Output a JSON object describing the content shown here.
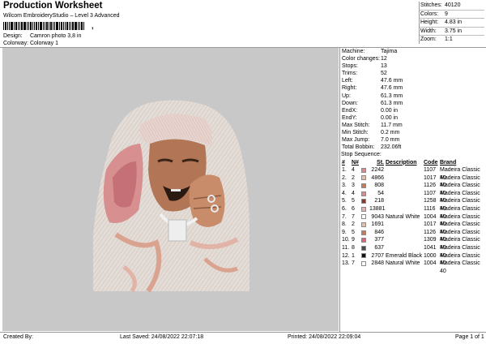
{
  "header": {
    "title": "Production Worksheet",
    "subtitle": "Wilcom EmbroideryStudio – Level 3 Advanced",
    "design_label": "Design:",
    "design_value": "Camron photo 3,8 in",
    "colorway_label": "Colorway:",
    "colorway_value": "Colorway 1"
  },
  "stats": [
    {
      "label": "Stitches:",
      "value": "40120"
    },
    {
      "label": "Colors:",
      "value": "9"
    },
    {
      "label": "Height:",
      "value": "4.83 in"
    },
    {
      "label": "Width:",
      "value": "3.75 in"
    },
    {
      "label": "Zoom:",
      "value": "1:1"
    }
  ],
  "properties": [
    {
      "label": "Machine:",
      "value": "Tajima"
    },
    {
      "label": "Color changes:",
      "value": "12"
    },
    {
      "label": "Stops:",
      "value": "13"
    },
    {
      "label": "Trims:",
      "value": "52"
    },
    {
      "label": "Left:",
      "value": "47.6 mm"
    },
    {
      "label": "Right:",
      "value": "47.6 mm"
    },
    {
      "label": "Up:",
      "value": "61.3 mm"
    },
    {
      "label": "Down:",
      "value": "61.3 mm"
    },
    {
      "label": "EndX:",
      "value": "0.00 in"
    },
    {
      "label": "EndY:",
      "value": "0.00 in"
    },
    {
      "label": "Max Stitch:",
      "value": "11.7 mm"
    },
    {
      "label": "Min Stitch:",
      "value": "0.2 mm"
    },
    {
      "label": "Max Jump:",
      "value": "7.0 mm"
    },
    {
      "label": "Total Bobbin:",
      "value": "232.06ft"
    }
  ],
  "stop_sequence": {
    "title": "Stop Sequence:",
    "headers": {
      "num": "#",
      "n": "N#",
      "st": "St.",
      "description": "Description",
      "code": "Code",
      "brand": "Brand"
    },
    "rows": [
      {
        "num": "1.",
        "n": "4",
        "color": "#d98a8e",
        "st": "2242",
        "description": "",
        "code": "1107",
        "brand": "Madeira Classic 40"
      },
      {
        "num": "2.",
        "n": "2",
        "color": "#e4c0a8",
        "st": "4866",
        "description": "",
        "code": "1017",
        "brand": "Madeira Classic 40"
      },
      {
        "num": "3.",
        "n": "3",
        "color": "#c9795c",
        "st": "808",
        "description": "",
        "code": "1126",
        "brand": "Madeira Classic 40"
      },
      {
        "num": "4.",
        "n": "4",
        "color": "#d98a8e",
        "st": "54",
        "description": "",
        "code": "1107",
        "brand": "Madeira Classic 40"
      },
      {
        "num": "5.",
        "n": "5",
        "color": "#8a3a2c",
        "st": "218",
        "description": "",
        "code": "1258",
        "brand": "Madeira Classic 40"
      },
      {
        "num": "6.",
        "n": "6",
        "color": "#e0b4b4",
        "st": "13881",
        "description": "",
        "code": "1116",
        "brand": "Madeira Classic 40"
      },
      {
        "num": "7.",
        "n": "7",
        "color": "#ffffff",
        "st": "9043",
        "description": "Natural White",
        "code": "1004",
        "brand": "Madeira Classic 40"
      },
      {
        "num": "8.",
        "n": "2",
        "color": "#e4c0a8",
        "st": "1691",
        "description": "",
        "code": "1017",
        "brand": "Madeira Classic 40"
      },
      {
        "num": "9.",
        "n": "5",
        "color": "#c9795c",
        "st": "846",
        "description": "",
        "code": "1126",
        "brand": "Madeira Classic 40"
      },
      {
        "num": "10.",
        "n": "9",
        "color": "#d9667a",
        "st": "377",
        "description": "",
        "code": "1309",
        "brand": "Madeira Classic 40"
      },
      {
        "num": "11.",
        "n": "8",
        "color": "#4a4a4a",
        "st": "637",
        "description": "",
        "code": "1041",
        "brand": "Madeira Classic 40"
      },
      {
        "num": "12.",
        "n": "1",
        "color": "#111111",
        "st": "2707",
        "description": "Emerald Black",
        "code": "1000",
        "brand": "Madeira Classic 40"
      },
      {
        "num": "13.",
        "n": "7",
        "color": "#ffffff",
        "st": "2848",
        "description": "Natural White",
        "code": "1004",
        "brand": "Madeira Classic 40"
      }
    ]
  },
  "footer": {
    "created_by": "Created By:",
    "last_saved": "Last Saved: 24/08/2022 22:07:18",
    "printed": "Printed: 24/08/2022 22:09:04",
    "page": "Page 1 of 1"
  }
}
